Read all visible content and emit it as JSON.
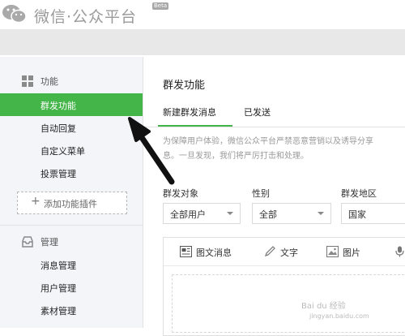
{
  "header": {
    "title": "微信·公众平台",
    "beta": "Beta",
    "logo_icon": "wechat-logo-icon"
  },
  "sidebar": {
    "sections": [
      {
        "title": "功能",
        "icon": "grid-icon",
        "items": [
          {
            "label": "群发功能",
            "active": true
          },
          {
            "label": "自动回复",
            "active": false
          },
          {
            "label": "自定义菜单",
            "active": false
          },
          {
            "label": "投票管理",
            "active": false
          }
        ],
        "add_plugin": "添加功能插件"
      },
      {
        "title": "管理",
        "icon": "inbox-icon",
        "items": [
          {
            "label": "消息管理",
            "active": false
          },
          {
            "label": "用户管理",
            "active": false
          },
          {
            "label": "素材管理",
            "active": false
          }
        ]
      }
    ]
  },
  "main": {
    "title": "群发功能",
    "tabs": [
      {
        "label": "新建群发消息",
        "active": true
      },
      {
        "label": "已发送",
        "active": false
      }
    ],
    "notice_line1": "为保障用户体验，微信公众平台严禁恶意营销以及诱导分享",
    "notice_line2": "息。一旦发现，我们将严厉打击和处理。",
    "filters": [
      {
        "label": "群发对象",
        "value": "全部用户"
      },
      {
        "label": "性别",
        "value": "全部"
      },
      {
        "label": "群发地区",
        "value": "国家"
      }
    ],
    "editor_tools": [
      {
        "label": "图文消息",
        "icon": "news-icon"
      },
      {
        "label": "文字",
        "icon": "pencil-icon"
      },
      {
        "label": "图片",
        "icon": "image-icon"
      },
      {
        "label": "",
        "icon": "microphone-icon"
      }
    ]
  },
  "watermark": {
    "line1": "Bai du 经验",
    "line2": "jingyan.baidu.com"
  },
  "colors": {
    "accent_green": "#44b549",
    "sidebar_bg": "#f4f5f9"
  }
}
